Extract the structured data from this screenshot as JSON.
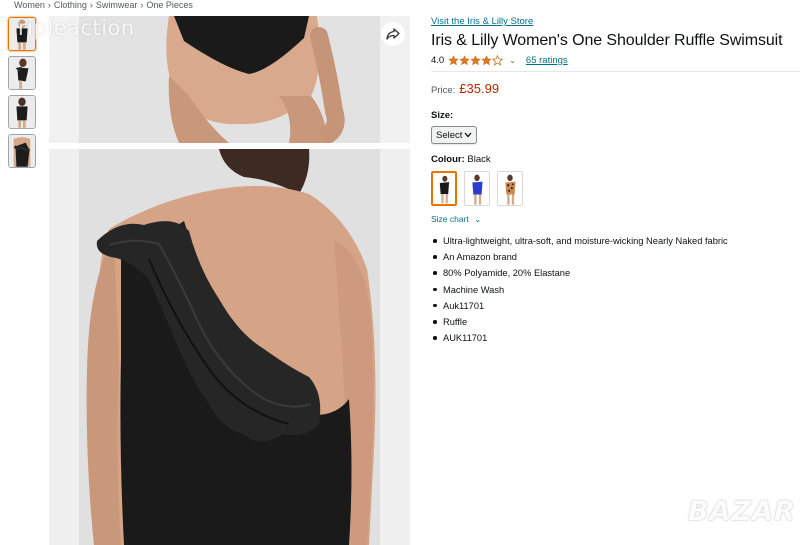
{
  "breadcrumb": {
    "items": [
      "Women",
      "Clothing",
      "Swimwear",
      "One Pieces"
    ],
    "separator": "›"
  },
  "watermark": {
    "top_text": "ripleaction",
    "bottom_logo": "BAZAR"
  },
  "gallery": {
    "thumbnails": [
      {
        "icon": "swimsuit-front-thumb",
        "active": true
      },
      {
        "icon": "swimsuit-side-thumb",
        "active": false
      },
      {
        "icon": "swimsuit-back-thumb",
        "active": false
      },
      {
        "icon": "swimsuit-ruffle-thumb",
        "active": false
      }
    ],
    "share_icon": "share-icon"
  },
  "product": {
    "store_link": "Visit the Iris & Lilly Store",
    "title": "Iris & Lilly Women's One Shoulder Ruffle Swimsuit",
    "rating_value": "4.0",
    "stars_filled": 4,
    "stars_total": 5,
    "ratings_count": "65 ratings",
    "price_label": "Price:",
    "price": "£35.99",
    "size_label": "Size:",
    "size_selected": "Select",
    "colour_label": "Colour:",
    "colour_value": "Black",
    "colour_swatches": [
      {
        "name": "black",
        "color": "#1a1a1a",
        "selected": true
      },
      {
        "name": "blue",
        "color": "#2d3fc9",
        "selected": false
      },
      {
        "name": "leopard",
        "color": "#b9794a",
        "selected": false
      }
    ],
    "size_chart": "Size chart",
    "bullets": [
      "Ultra-lightweight, ultra-soft, and moisture-wicking Nearly Naked fabric",
      "An Amazon brand",
      "80% Polyamide, 20% Elastane",
      "Machine Wash",
      "Auk11701",
      "Ruffle",
      "AUK11701"
    ]
  },
  "colors": {
    "link": "#007185",
    "price": "#b12704",
    "star": "#de7921",
    "selected_border": "#e77600"
  }
}
